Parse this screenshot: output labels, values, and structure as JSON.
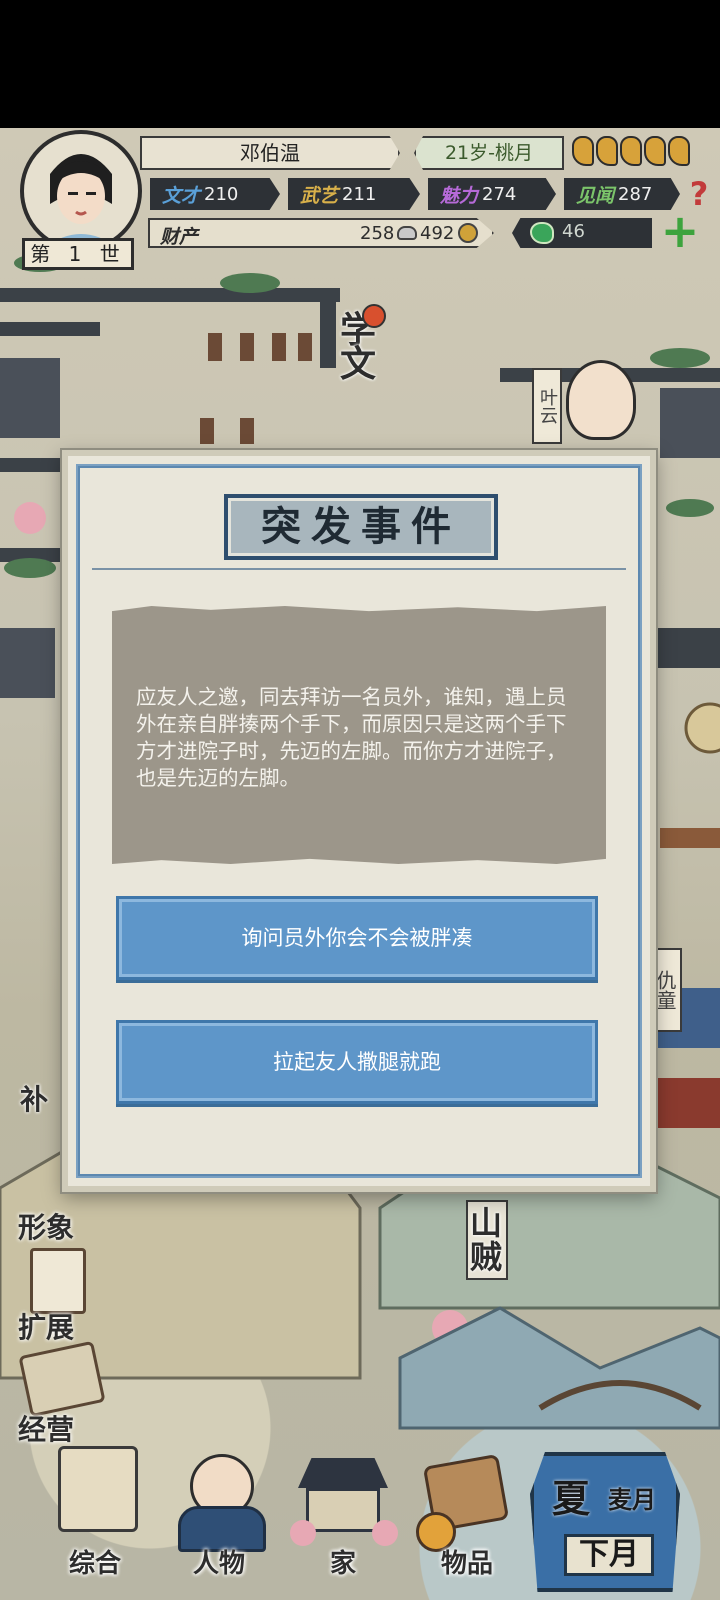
{
  "header": {
    "name": "邓伯温",
    "age_month": "21岁-桃月",
    "generation": "第 1 世",
    "stats": [
      {
        "label": "文才",
        "value": "210",
        "color": "#5aa0d8"
      },
      {
        "label": "武艺",
        "value": "211",
        "color": "#d8b04a"
      },
      {
        "label": "魅力",
        "value": "274",
        "color": "#b66ad8"
      },
      {
        "label": "见闻",
        "value": "287",
        "color": "#7bc46a"
      }
    ],
    "wealth_label": "财产",
    "silver": "258",
    "copper": "492",
    "jade": "46"
  },
  "map": {
    "labels": {
      "academy": "学文",
      "ye_yun": "叶云",
      "qiu_tong": "仇童",
      "mountain_bandit": "山贼",
      "bu": "补"
    }
  },
  "dialog": {
    "title": "突发事件",
    "story": "应友人之邀，同去拜访一名员外，谁知，遇上员外在亲自胖揍两个手下，而原因只是这两个手下方才进院子时，先迈的左脚。而你方才进院子，也是先迈的左脚。",
    "choices": [
      {
        "label": "询问员外你会不会被胖凑"
      },
      {
        "label": "拉起友人撒腿就跑"
      }
    ]
  },
  "side_menu": {
    "appearance": "形象",
    "expand": "扩展",
    "manage": "经营"
  },
  "bottom_nav": [
    {
      "label": "综合"
    },
    {
      "label": "人物"
    },
    {
      "label": "家"
    },
    {
      "label": "物品"
    }
  ],
  "season": {
    "season": "夏",
    "month_name": "麦月",
    "period": "下月"
  },
  "colors": {
    "dialog_button": "#5e96c9",
    "dialog_frame": "#5c88b0",
    "story_box": "#9c968a"
  }
}
